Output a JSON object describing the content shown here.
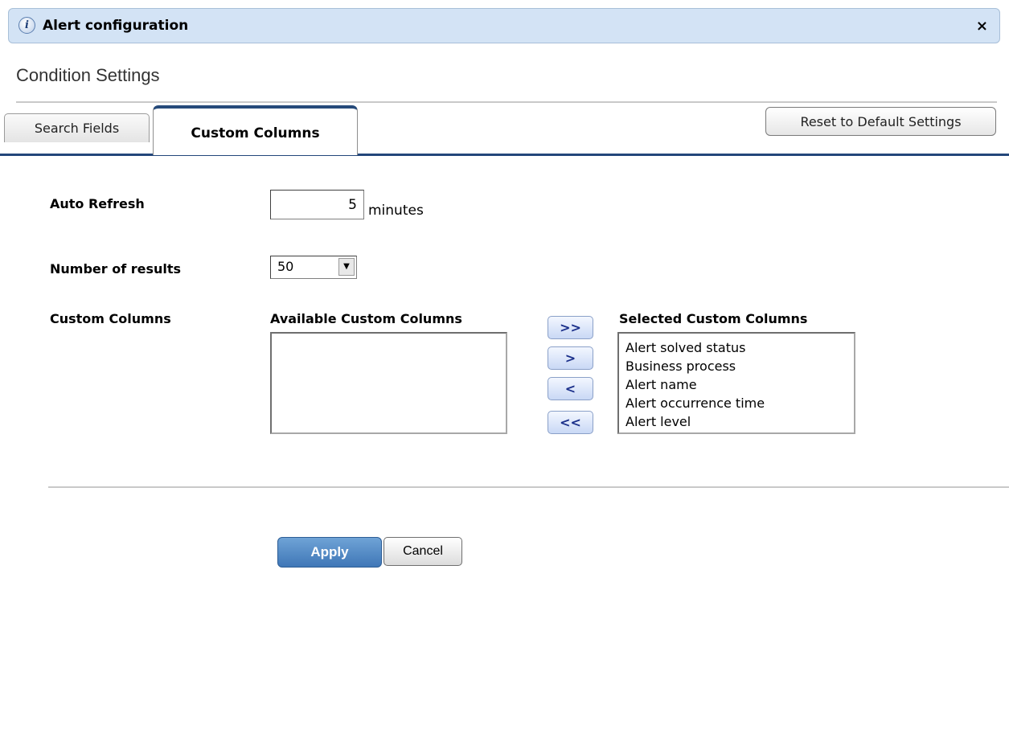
{
  "dialog": {
    "title": "Alert configuration",
    "info_icon": "info-icon",
    "info_glyph": "i",
    "close_icon": "close-icon",
    "close_glyph": "×"
  },
  "section_title": "Condition Settings",
  "tabs": [
    {
      "label": "Search Fields",
      "active": false
    },
    {
      "label": "Custom Columns",
      "active": true
    }
  ],
  "reset_label": "Reset to Default Settings",
  "auto_refresh": {
    "label": "Auto Refresh",
    "value": "5",
    "unit": "minutes"
  },
  "number_of_results": {
    "label": "Number of results",
    "value": "50",
    "arrow_glyph": "▼"
  },
  "custom_columns": {
    "label": "Custom Columns",
    "available_header": "Available Custom Columns",
    "selected_header": "Selected Custom Columns",
    "available": [],
    "selected": [
      "Alert solved status",
      "Business process",
      "Alert name",
      "Alert occurrence time",
      "Alert level"
    ],
    "buttons": {
      "add_all": ">>",
      "add": ">",
      "remove": "<",
      "remove_all": "<<"
    }
  },
  "actions": {
    "apply": "Apply",
    "cancel": "Cancel"
  },
  "colors": {
    "title_bar": "#d3e3f5",
    "tab_accent": "#23467a",
    "apply_button": "#4a82c0"
  }
}
